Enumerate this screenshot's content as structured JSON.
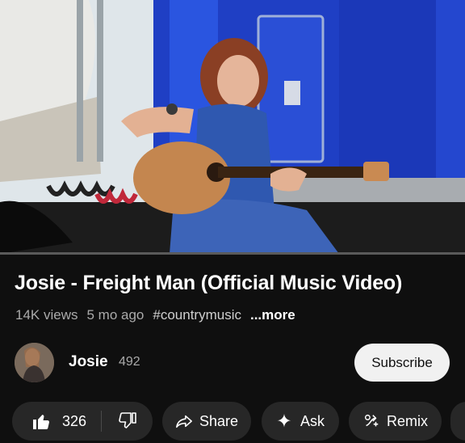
{
  "video": {
    "title": "Josie - Freight Man (Official Music Video)",
    "progress_fraction": 0
  },
  "meta": {
    "views": "14K views",
    "age": "5 mo ago",
    "hashtag": "#countrymusic",
    "more": "...more"
  },
  "channel": {
    "name": "Josie",
    "subscribers": "492",
    "subscribe_label": "Subscribe"
  },
  "actions": {
    "like_count": "326",
    "share_label": "Share",
    "ask_label": "Ask",
    "remix_label": "Remix"
  },
  "icons": {
    "like": "thumbs-up-icon",
    "dislike": "thumbs-down-icon",
    "share": "share-arrow-icon",
    "ask": "sparkle-icon",
    "remix": "remix-icon"
  },
  "colors": {
    "background": "#0f0f0f",
    "pill": "#272727",
    "subscribe_bg": "#f1f1f1",
    "secondary_text": "#aaaaaa",
    "progress": "#ff0000"
  }
}
